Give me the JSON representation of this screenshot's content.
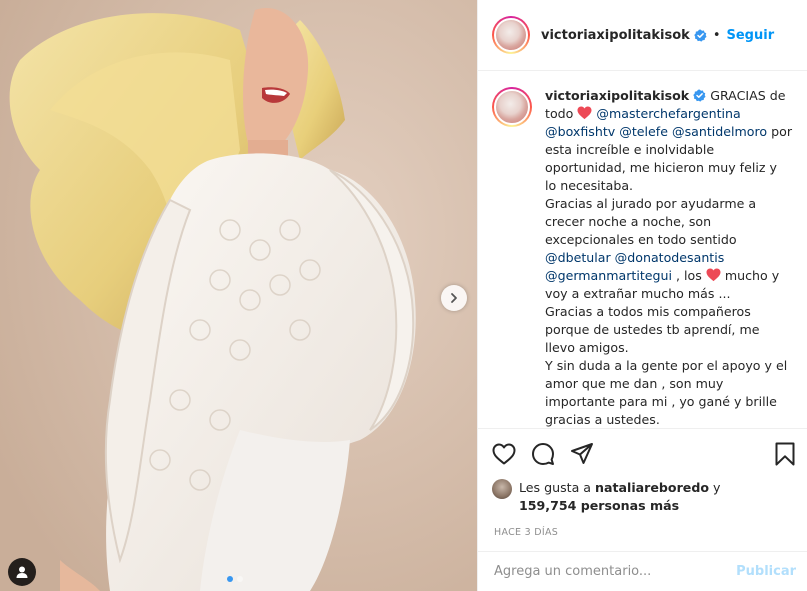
{
  "post": {
    "username": "victoriaxipolitakisok",
    "verified": true,
    "follow_label": "Seguir",
    "bullet": "•"
  },
  "caption": {
    "username": "victoriaxipolitakisok",
    "p1_a": "GRACIAS de todo",
    "p1_mention1": "@masterchefargentina",
    "p1_mention2": "@boxfishtv",
    "p1_mention3": "@telefe",
    "p1_mention4": "@santidelmoro",
    "p1_b": "por esta increíble e inolvidable oportunidad, me hicieron muy feliz y lo necesitaba.",
    "p2_a": "Gracias al jurado por ayudarme a crecer noche a noche, son excepcionales en todo sentido",
    "p2_mention1": "@dbetular",
    "p2_mention2": "@donatodesantis",
    "p2_mention3": "@germanmartitegui",
    "p2_b": ", los",
    "p2_c": "mucho y voy a extrañar mucho más ...",
    "p3": "Gracias a todos mis compañeros porque de ustedes tb aprendí, me llevo amigos.",
    "p4": "Y sin duda a la gente por el apoyo y el amor que me dan , son muy importante para mi , yo gané y brille gracias a ustedes."
  },
  "likes": {
    "prefix": "Les gusta a",
    "first_user": "natalіareboredo",
    "connector": "y",
    "count": "159,754 personas más"
  },
  "time_ago": "HACE 3 DÍAS",
  "comment": {
    "placeholder": "Agrega un comentario...",
    "publish_label": "Publicar"
  },
  "carousel": {
    "total": 2,
    "active_index": 0
  },
  "colors": {
    "link": "#00376b",
    "follow": "#0095f6",
    "heart": "#ed4956",
    "verified": "#3897f0",
    "publish_disabled": "#b2dffc"
  }
}
